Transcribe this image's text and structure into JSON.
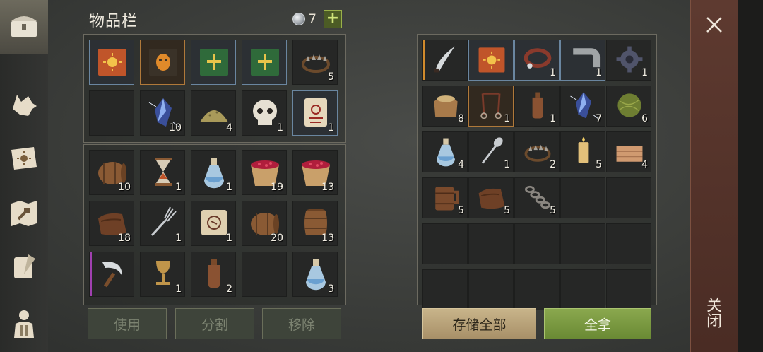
{
  "inventory": {
    "title": "物品栏",
    "gem_count": "7",
    "plus": "+",
    "buttons": {
      "use": "使用",
      "split": "分割",
      "remove": "移除"
    }
  },
  "storage": {
    "buttons": {
      "store_all": "存储全部",
      "take_all": "全拿"
    }
  },
  "close_label": "关闭",
  "colors": {
    "accent_green": "#7f9c44",
    "accent_tan": "#bba67c",
    "close_panel": "#5a372d"
  },
  "inventory_rows": [
    [
      {
        "icon": "sun-book-icon",
        "count": "",
        "hl": "blue"
      },
      {
        "icon": "mask-book-icon",
        "count": "",
        "hl": "orange"
      },
      {
        "icon": "green-cross-book-icon",
        "count": "",
        "hl": "blue"
      },
      {
        "icon": "green-cross-book-icon",
        "count": "",
        "hl": "blue"
      },
      {
        "icon": "bear-trap-icon",
        "count": "5",
        "hl": ""
      }
    ],
    [
      {
        "icon": "",
        "count": "",
        "hl": ""
      },
      {
        "icon": "crystal-icon",
        "count": "10",
        "hl": ""
      },
      {
        "icon": "sand-pile-icon",
        "count": "4",
        "hl": ""
      },
      {
        "icon": "skull-icon",
        "count": "1",
        "hl": ""
      },
      {
        "icon": "blood-scroll-icon",
        "count": "1",
        "hl": "blue"
      }
    ],
    [
      {
        "icon": "barrel-side-icon",
        "count": "10",
        "hl": ""
      },
      {
        "icon": "hourglass-icon",
        "count": "1",
        "hl": ""
      },
      {
        "icon": "potion-flask-icon",
        "count": "1",
        "hl": ""
      },
      {
        "icon": "berry-bucket-icon",
        "count": "19",
        "hl": ""
      },
      {
        "icon": "berry-bucket-icon",
        "count": "13",
        "hl": ""
      }
    ],
    [
      {
        "icon": "leather-icon",
        "count": "18",
        "hl": ""
      },
      {
        "icon": "fork-icon",
        "count": "1",
        "hl": ""
      },
      {
        "icon": "map-scroll-icon",
        "count": "1",
        "hl": ""
      },
      {
        "icon": "barrel-side-icon",
        "count": "20",
        "hl": ""
      },
      {
        "icon": "barrel-upright-icon",
        "count": "13",
        "hl": ""
      }
    ],
    [
      {
        "icon": "sickle-icon",
        "count": "",
        "hl": "",
        "flag": "#a040b0"
      },
      {
        "icon": "goblet-icon",
        "count": "1",
        "hl": ""
      },
      {
        "icon": "bottle-icon",
        "count": "2",
        "hl": ""
      },
      {
        "icon": "",
        "count": "",
        "hl": ""
      },
      {
        "icon": "potion-flask-icon",
        "count": "3",
        "hl": ""
      }
    ]
  ],
  "storage_rows": [
    [
      {
        "icon": "curved-blade-icon",
        "count": "",
        "hl": "",
        "flag": "#d08a2c"
      },
      {
        "icon": "sun-book-icon",
        "count": "",
        "hl": "blue"
      },
      {
        "icon": "collar-icon",
        "count": "1",
        "hl": "blue"
      },
      {
        "icon": "pipe-fitting-icon",
        "count": "1",
        "hl": "blue"
      },
      {
        "icon": "gear-icon",
        "count": "1",
        "hl": ""
      }
    ],
    [
      {
        "icon": "grain-sack-icon",
        "count": "8",
        "hl": ""
      },
      {
        "icon": "bridle-icon",
        "count": "1",
        "hl": "orange"
      },
      {
        "icon": "bottle-icon",
        "count": "1",
        "hl": ""
      },
      {
        "icon": "crystal-icon",
        "count": "7",
        "hl": ""
      },
      {
        "icon": "herb-ball-icon",
        "count": "6",
        "hl": ""
      }
    ],
    [
      {
        "icon": "potion-flask-icon",
        "count": "4",
        "hl": ""
      },
      {
        "icon": "spoon-icon",
        "count": "1",
        "hl": ""
      },
      {
        "icon": "bear-trap-icon",
        "count": "2",
        "hl": ""
      },
      {
        "icon": "candle-icon",
        "count": "5",
        "hl": ""
      },
      {
        "icon": "cloth-icon",
        "count": "4",
        "hl": ""
      }
    ],
    [
      {
        "icon": "mug-icon",
        "count": "5",
        "hl": ""
      },
      {
        "icon": "leather-icon",
        "count": "5",
        "hl": ""
      },
      {
        "icon": "chain-icon",
        "count": "5",
        "hl": ""
      },
      {
        "icon": "",
        "count": "",
        "hl": ""
      },
      {
        "icon": "",
        "count": "",
        "hl": ""
      }
    ],
    [
      {
        "icon": "",
        "count": "",
        "hl": ""
      },
      {
        "icon": "",
        "count": "",
        "hl": ""
      },
      {
        "icon": "",
        "count": "",
        "hl": ""
      },
      {
        "icon": "",
        "count": "",
        "hl": ""
      },
      {
        "icon": "",
        "count": "",
        "hl": ""
      }
    ],
    [
      {
        "icon": "",
        "count": "",
        "hl": ""
      },
      {
        "icon": "",
        "count": "",
        "hl": ""
      },
      {
        "icon": "",
        "count": "",
        "hl": ""
      },
      {
        "icon": "",
        "count": "",
        "hl": ""
      },
      {
        "icon": "",
        "count": "",
        "hl": ""
      }
    ]
  ],
  "sidebar": [
    {
      "icon": "chest-icon"
    },
    {
      "icon": "wolf-icon"
    },
    {
      "icon": "sun-book-nav-icon"
    },
    {
      "icon": "map-arrow-icon"
    },
    {
      "icon": "scroll-quill-icon"
    },
    {
      "icon": "character-icon"
    }
  ]
}
